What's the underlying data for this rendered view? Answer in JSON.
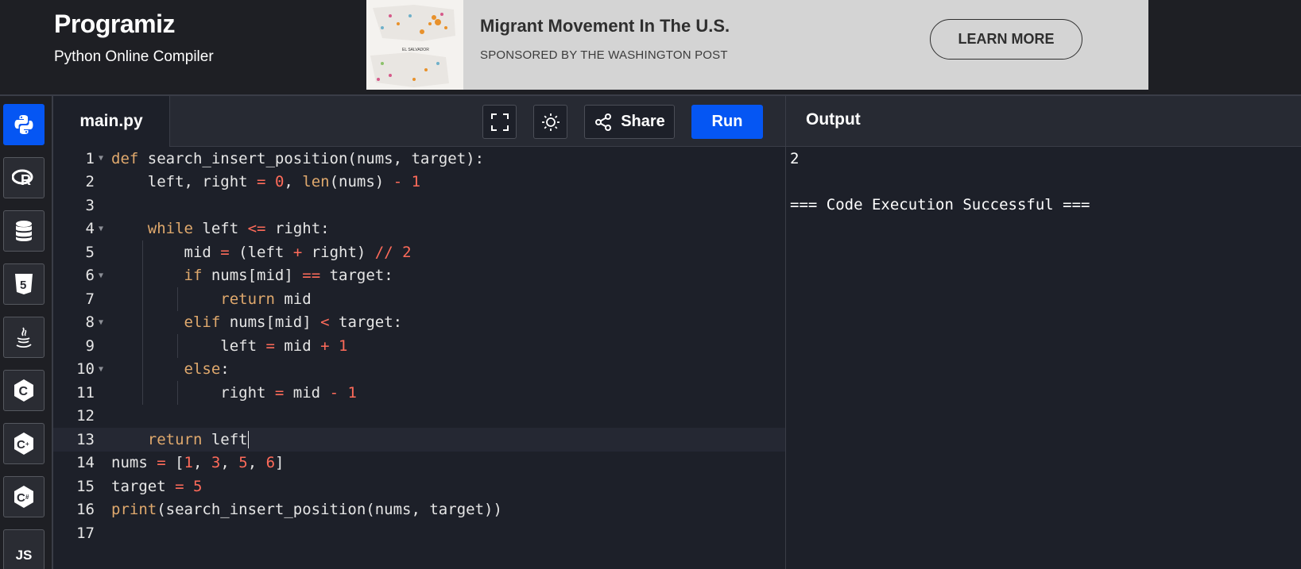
{
  "header": {
    "brand": "Programiz",
    "subtitle": "Python Online Compiler"
  },
  "ad": {
    "title": "Migrant Movement In The U.S.",
    "sponsor": "SPONSORED BY THE WASHINGTON POST",
    "button": "LEARN MORE",
    "map_label": "EL SALVADOR"
  },
  "sidebar": {
    "items": [
      {
        "name": "python",
        "icon": "python-icon",
        "active": true
      },
      {
        "name": "r",
        "icon": "r-icon"
      },
      {
        "name": "sql",
        "icon": "database-icon"
      },
      {
        "name": "html",
        "icon": "html5-icon"
      },
      {
        "name": "java",
        "icon": "java-icon"
      },
      {
        "name": "c",
        "icon": "c-icon"
      },
      {
        "name": "cpp",
        "icon": "cpp-icon"
      },
      {
        "name": "csharp",
        "icon": "csharp-icon"
      },
      {
        "name": "js",
        "icon": "js-icon",
        "label": "JS"
      }
    ]
  },
  "toolbar": {
    "file_tab": "main.py",
    "share_label": "Share",
    "run_label": "Run"
  },
  "editor": {
    "line_numbers": [
      "1",
      "2",
      "3",
      "4",
      "5",
      "6",
      "7",
      "8",
      "9",
      "10",
      "11",
      "12",
      "13",
      "14",
      "15",
      "16",
      "17"
    ]
  },
  "output": {
    "title": "Output",
    "lines": [
      "2",
      "",
      "=== Code Execution Successful ==="
    ]
  },
  "colors": {
    "accent": "#0556f3",
    "keyword": "#e0a96d",
    "number": "#ff6b5a",
    "background": "#1d2029"
  }
}
